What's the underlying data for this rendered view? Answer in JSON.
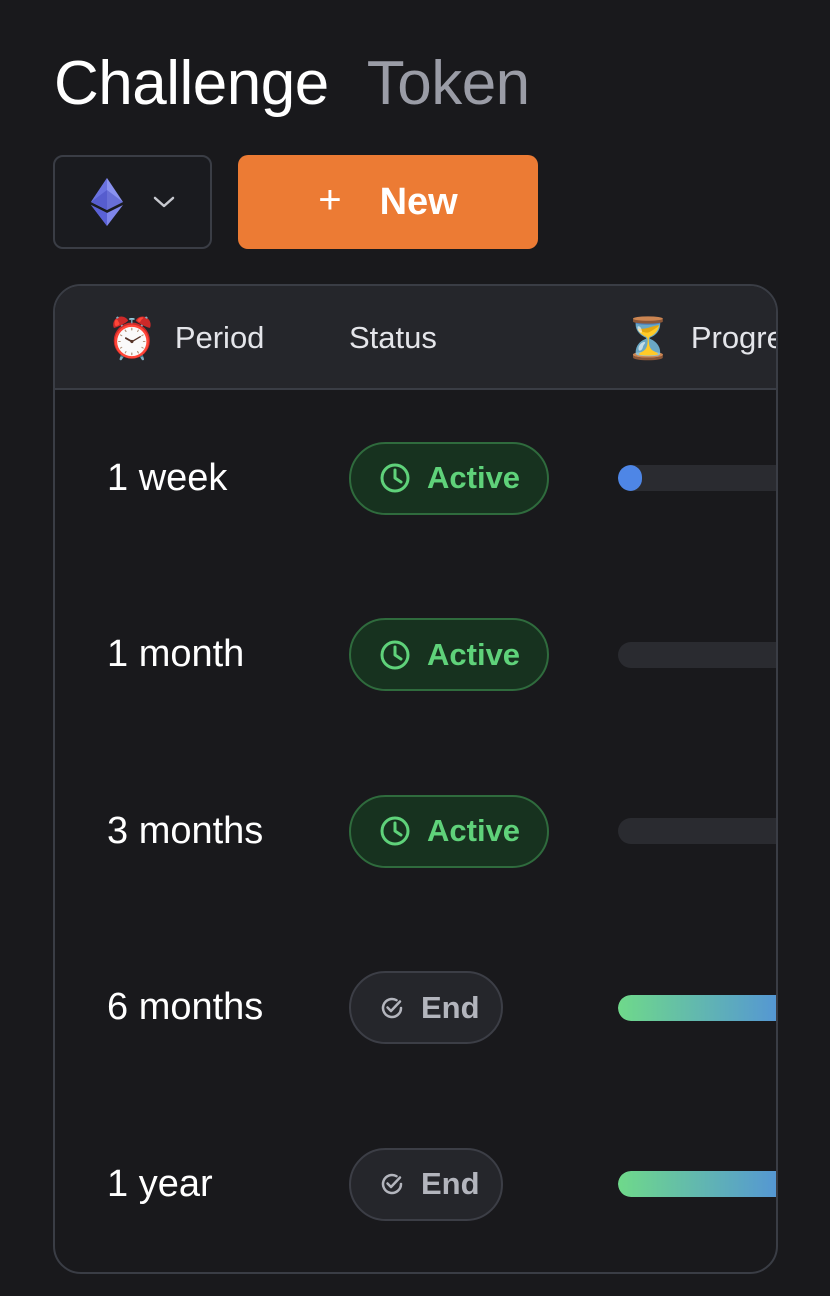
{
  "header": {
    "tabs": [
      {
        "label": "Challenge",
        "active": true
      },
      {
        "label": "Token",
        "active": false
      }
    ]
  },
  "toolbar": {
    "network_icon": "ethereum-icon",
    "dropdown_icon": "chevron-down-icon",
    "new_button": {
      "icon": "plus",
      "symbol": "+",
      "label": "New"
    }
  },
  "table": {
    "columns": [
      {
        "emoji": "⏰",
        "label": "Period"
      },
      {
        "emoji": "",
        "label": "Status"
      },
      {
        "emoji": "⏳",
        "label": "Progre"
      }
    ],
    "rows": [
      {
        "period": "1 week",
        "status": "Active",
        "status_icon": "clock-icon",
        "progress": 0.12
      },
      {
        "period": "1 month",
        "status": "Active",
        "status_icon": "clock-icon",
        "progress": 0.0
      },
      {
        "period": "3 months",
        "status": "Active",
        "status_icon": "clock-icon",
        "progress": 0.0
      },
      {
        "period": "6 months",
        "status": "End",
        "status_icon": "check-circle-icon",
        "progress": 1.0
      },
      {
        "period": "1 year",
        "status": "End",
        "status_icon": "check-circle-icon",
        "progress": 1.0
      }
    ]
  },
  "colors": {
    "background": "#19191c",
    "accent": "#ec7b34",
    "active_green": "#5fd27a",
    "progress_blue": "#4e86e6",
    "progress_gradient_start": "#6fd98a",
    "progress_gradient_end": "#4e86e6"
  }
}
